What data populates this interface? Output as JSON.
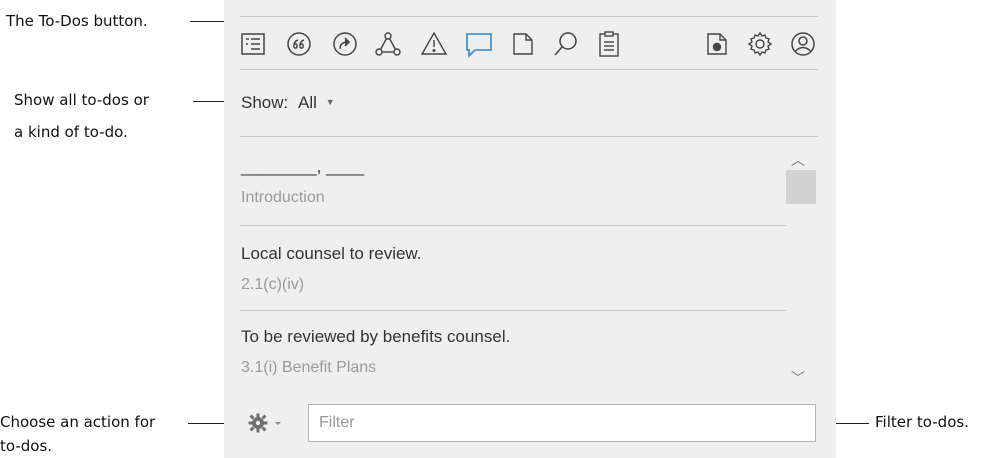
{
  "callouts": {
    "todos_button": "The To-Dos button.",
    "show_line1": "Show all to-dos or",
    "show_line2": "a kind of to-do.",
    "action_line1": "Choose an action for",
    "action_line2": "to-dos.",
    "filter": "Filter to-dos."
  },
  "toolbar": {
    "icons": [
      "outline-icon",
      "quote-icon",
      "share-icon",
      "network-icon",
      "warning-icon",
      "todos-icon",
      "document-icon",
      "search-icon",
      "clipboard-icon",
      "document-settings-icon",
      "gear-icon",
      "user-icon"
    ],
    "active": "todos-icon",
    "active_color": "#2a8ad4"
  },
  "show": {
    "label": "Show:",
    "value": "All"
  },
  "todos": [
    {
      "title": "________, ____",
      "location": "Introduction"
    },
    {
      "title": "Local counsel to review.",
      "location": "2.1(c)(iv)"
    },
    {
      "title": "To be reviewed by benefits counsel.",
      "location": "3.1(i) Benefit Plans"
    }
  ],
  "filter": {
    "placeholder": "Filter",
    "value": ""
  }
}
